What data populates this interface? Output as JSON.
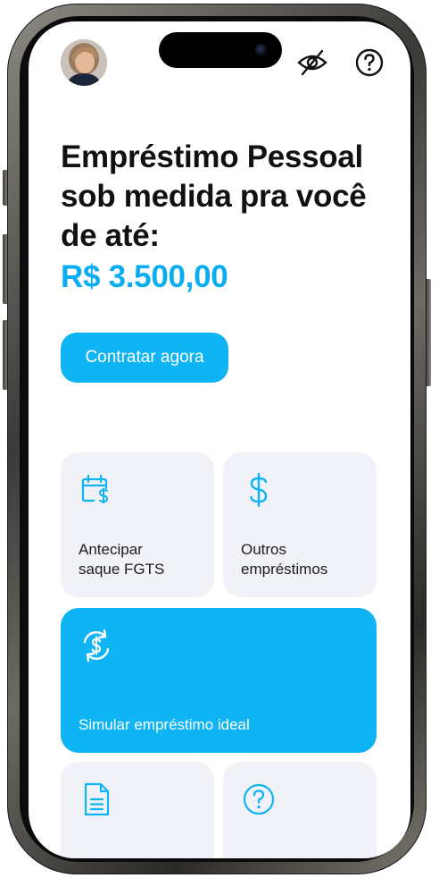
{
  "header": {
    "avatar_alt": "profile photo",
    "icons": [
      "eye-off-icon",
      "help-circle-icon"
    ]
  },
  "hero": {
    "headline": "Empréstimo Pessoal sob medida pra você de até:",
    "amount": "R$ 3.500,00",
    "cta_label": "Contratar agora"
  },
  "tiles": [
    {
      "label": "Antecipar saque FGTS",
      "icon": "calendar-dollar-icon"
    },
    {
      "label": "Outros empréstimos",
      "icon": "dollar-icon"
    },
    {
      "label": "Simular empréstimo ideal",
      "icon": "refresh-dollar-icon"
    },
    {
      "label": "",
      "icon": "document-icon"
    },
    {
      "label": "",
      "icon": "help-circle-icon"
    }
  ],
  "colors": {
    "accent": "#0fb4f5",
    "amount_text": "#0aaef0",
    "tile_background": "#f1f2f7",
    "headline_text": "#111111"
  }
}
